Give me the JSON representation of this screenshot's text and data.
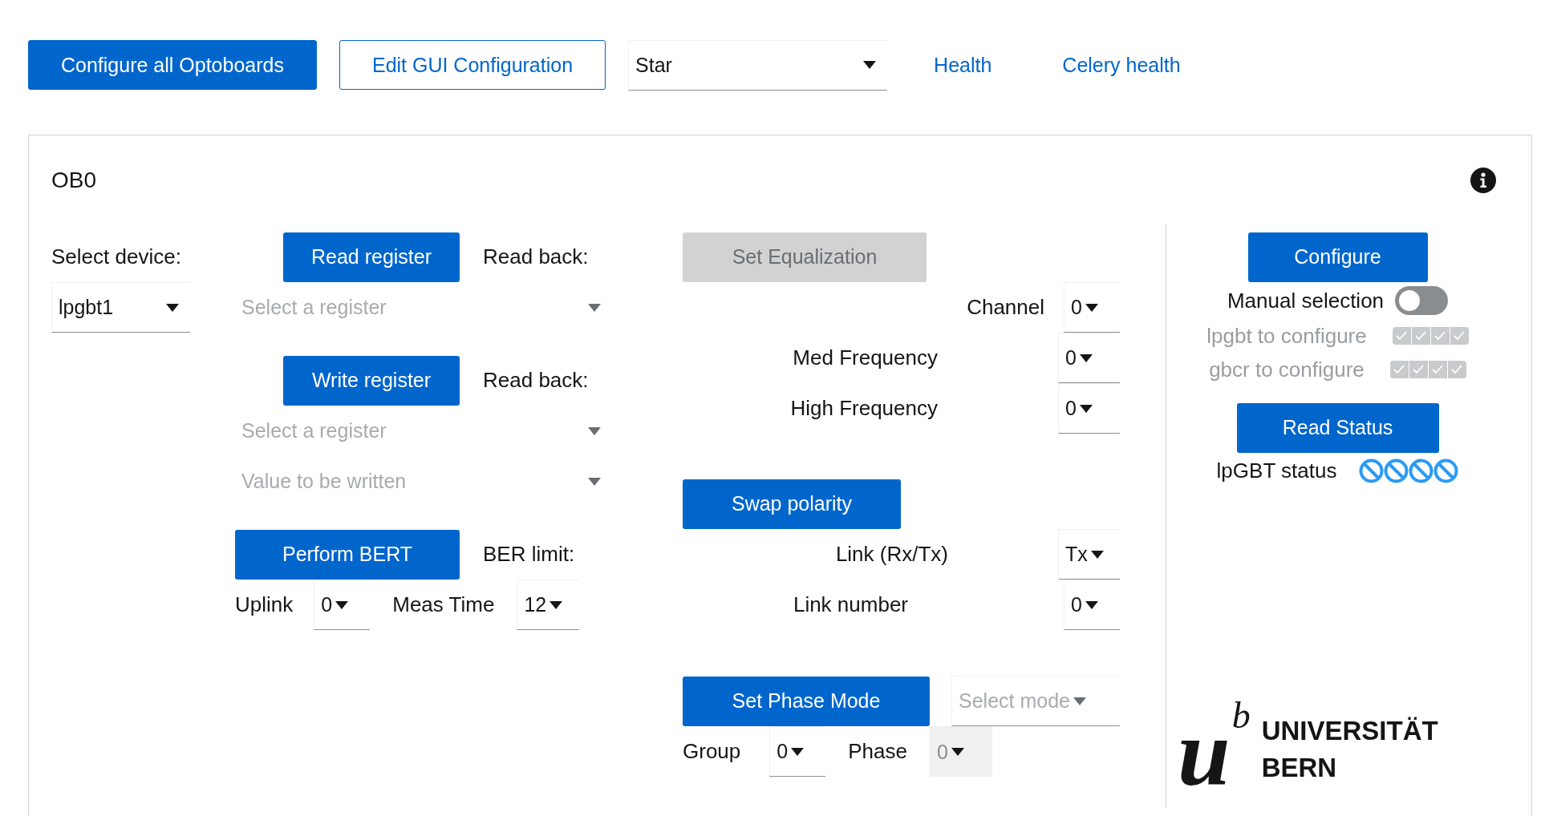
{
  "toolbar": {
    "buttons": [
      {
        "label": "Configure all Optoboards",
        "kind": "primary"
      },
      {
        "label": "Edit GUI Configuration",
        "kind": "secondary"
      }
    ],
    "select": {
      "value": "Star"
    },
    "links": [
      "Health",
      "Celery health"
    ]
  },
  "card": {
    "title": "OB0",
    "device": {
      "label": "Select device:",
      "value": "lpgbt1"
    },
    "read": {
      "button": "Read register",
      "readback_label": "Read back:",
      "register_placeholder": "Select a register"
    },
    "write": {
      "button": "Write register",
      "readback_label": "Read back:",
      "register_placeholder": "Select a register",
      "value_placeholder": "Value to be written"
    },
    "bert": {
      "button": "Perform BERT",
      "limit_label": "BER limit:",
      "uplink_label": "Uplink",
      "uplink_value": "0",
      "meas_time_label": "Meas Time",
      "meas_time_value": "12"
    },
    "equalization": {
      "button": {
        "label": "Set Equalization",
        "disabled": true
      },
      "fields": [
        {
          "label": "Channel",
          "value": "0"
        },
        {
          "label": "Med Frequency",
          "value": "0"
        },
        {
          "label": "High Frequency",
          "value": "0"
        }
      ]
    },
    "polarity": {
      "button": "Swap polarity",
      "fields": [
        {
          "label": "Link (Rx/Tx)",
          "value": "Tx"
        },
        {
          "label": "Link number",
          "value": "0"
        }
      ]
    },
    "phase": {
      "button": "Set Phase Mode",
      "mode_placeholder": "Select mode",
      "group_label": "Group",
      "group_value": "0",
      "phase_label": "Phase",
      "phase_value": "0",
      "phase_disabled": true
    },
    "configure": {
      "button": "Configure",
      "manual_selection": {
        "label": "Manual selection",
        "on": false
      },
      "targets": [
        {
          "label": "lpgbt to configure",
          "disabled": true,
          "checks": [
            {
              "checked": true
            },
            {
              "checked": true
            },
            {
              "checked": true
            },
            {
              "checked": true
            }
          ]
        },
        {
          "label": "gbcr to configure",
          "disabled": true,
          "checks": [
            {
              "checked": true
            },
            {
              "checked": true
            },
            {
              "checked": true
            },
            {
              "checked": true
            }
          ]
        }
      ]
    },
    "status": {
      "button": "Read Status",
      "label": "lpGBT status",
      "indicators": [
        {
          "kind": "blocked"
        },
        {
          "kind": "blocked"
        },
        {
          "kind": "blocked"
        },
        {
          "kind": "blocked"
        }
      ]
    },
    "logo": {
      "mark": "u",
      "superscript": "b",
      "lines": [
        "UNIVERSITÄT",
        "BERN"
      ]
    }
  }
}
